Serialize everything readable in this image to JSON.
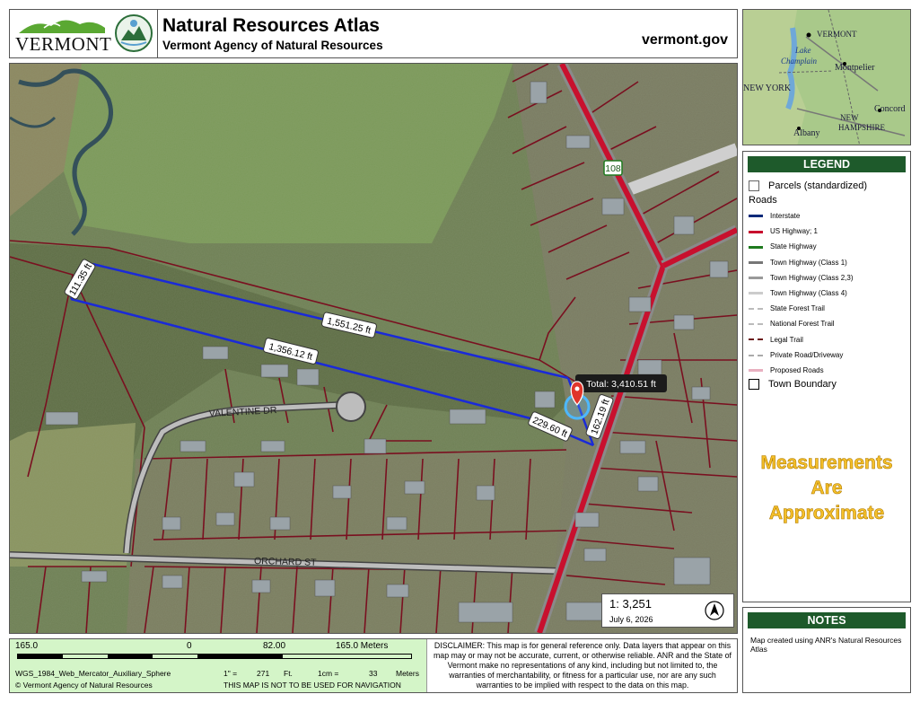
{
  "header": {
    "logo_text": "VERMONT",
    "title": "Natural Resources Atlas",
    "subtitle": "Vermont Agency of Natural Resources",
    "site": "vermont.gov"
  },
  "overview": {
    "labels": [
      "VERMONT",
      "Lake",
      "Champlain",
      "Montpelier",
      "NEW YORK",
      "Concord",
      "NEW",
      "HAMPSHIRE",
      "Albany"
    ]
  },
  "map": {
    "street_labels": [
      "VALENTINE DR",
      "ORCHARD ST"
    ],
    "route_shield": "108",
    "measurements": [
      "111.35 ft",
      "1,551.25 ft",
      "1,356.12 ft",
      "229.60 ft",
      "162.19 ft"
    ],
    "total_label": "Total: 3,410.51 ft",
    "scale_ratio": "1:  3,251",
    "date": "July 6, 2026"
  },
  "legend": {
    "title": "LEGEND",
    "parcels": "Parcels (standardized)",
    "roads_heading": "Roads",
    "roads": [
      {
        "label": "Interstate",
        "color": "#0b2a7a"
      },
      {
        "label": "US Highway; 1",
        "color": "#c8102e"
      },
      {
        "label": "State Highway",
        "color": "#1e7a1e"
      },
      {
        "label": "Town Highway (Class 1)",
        "color": "#777777"
      },
      {
        "label": "Town Highway (Class 2,3)",
        "color": "#999999"
      },
      {
        "label": "Town Highway (Class 4)",
        "color": "#cccccc"
      },
      {
        "label": "State Forest Trail",
        "color": "#bbbbbb"
      },
      {
        "label": "National Forest Trail",
        "color": "#bbbbbb"
      },
      {
        "label": "Legal Trail",
        "color": "#6b1a1a"
      },
      {
        "label": "Private Road/Driveway",
        "color": "#aaaaaa"
      },
      {
        "label": "Proposed Roads",
        "color": "#e8b0c0"
      }
    ],
    "town_boundary": "Town Boundary",
    "warning": [
      "Measurements",
      "Are",
      "Approximate"
    ]
  },
  "notes": {
    "title": "NOTES",
    "text": "Map created using ANR's Natural Resources Atlas"
  },
  "footer": {
    "scale_labels": [
      "165.0",
      "0",
      "82.00",
      "165.0 Meters"
    ],
    "projection": "WGS_1984_Web_Mercator_Auxiliary_Sphere",
    "inch_label": "1\" =",
    "inch_value": "271",
    "inch_unit": "Ft.",
    "cm_label": "1cm =",
    "cm_value": "33",
    "cm_unit": "Meters",
    "copyright": "© Vermont Agency of Natural Resources",
    "nav_warning": "THIS MAP IS NOT TO BE USED FOR NAVIGATION",
    "disclaimer": "DISCLAIMER: This map is for general reference only. Data layers that appear on this map may or may not be accurate, current, or otherwise reliable. ANR and the State of Vermont make no representations of any kind, including but not limited to, the warranties of merchantability, or fitness for a particular use, nor are any such warranties to be implied with respect to the data on this map."
  }
}
